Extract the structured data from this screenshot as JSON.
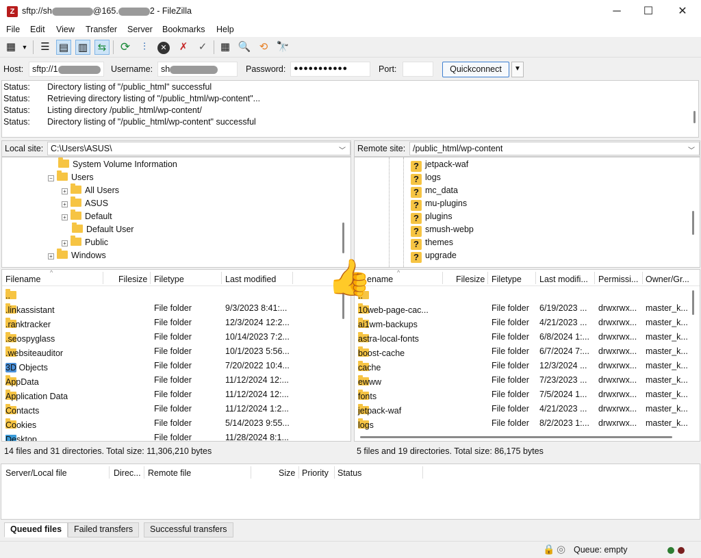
{
  "window": {
    "title_prefix": "sftp://sh",
    "title_mid": "@165.",
    "title_suffix": "2 - FileZilla",
    "app_icon": "Z"
  },
  "menu": [
    "File",
    "Edit",
    "View",
    "Transfer",
    "Server",
    "Bookmarks",
    "Help"
  ],
  "toolbar": {
    "icons": [
      "site-manager",
      "dropdown",
      "toggle-log",
      "toggle-local-tree",
      "toggle-remote-tree",
      "toggle-queue",
      "refresh",
      "process-queue",
      "cancel",
      "disconnect",
      "reconnect",
      "directory-compare",
      "filter",
      "sync-browsing",
      "search"
    ]
  },
  "quickconnect": {
    "host_label": "Host:",
    "host_value": "sftp://1",
    "username_label": "Username:",
    "username_value": "sh",
    "password_label": "Password:",
    "password_value": "●●●●●●●●●●●",
    "port_label": "Port:",
    "port_value": "",
    "button_label": "Quickconnect"
  },
  "log": [
    {
      "label": "Status:",
      "text": "Directory listing of \"/public_html\" successful"
    },
    {
      "label": "Status:",
      "text": "Retrieving directory listing of \"/public_html/wp-content\"..."
    },
    {
      "label": "Status:",
      "text": "Listing directory /public_html/wp-content/"
    },
    {
      "label": "Status:",
      "text": "Directory listing of \"/public_html/wp-content\" successful"
    }
  ],
  "local": {
    "site_label": "Local site:",
    "path": "C:\\Users\\ASUS\\",
    "tree": [
      {
        "name": "System Volume Information",
        "expander": ""
      },
      {
        "name": "Users",
        "expander": "−"
      },
      {
        "name": "All Users",
        "expander": "+"
      },
      {
        "name": "ASUS",
        "expander": "+"
      },
      {
        "name": "Default",
        "expander": "+"
      },
      {
        "name": "Default User",
        "expander": ""
      },
      {
        "name": "Public",
        "expander": "+"
      },
      {
        "name": "Windows",
        "expander": "+"
      }
    ],
    "columns": [
      "Filename",
      "Filesize",
      "Filetype",
      "Last modified"
    ],
    "files": [
      {
        "name": "..",
        "type": "",
        "modified": ""
      },
      {
        "name": ".linkassistant",
        "type": "File folder",
        "modified": "9/3/2023 8:41:..."
      },
      {
        "name": ".ranktracker",
        "type": "File folder",
        "modified": "12/3/2024 12:2..."
      },
      {
        "name": ".seospyglass",
        "type": "File folder",
        "modified": "10/14/2023 7:2..."
      },
      {
        "name": ".websiteauditor",
        "type": "File folder",
        "modified": "10/1/2023 5:56..."
      },
      {
        "name": "3D Objects",
        "type": "File folder",
        "modified": "7/20/2022 10:4..."
      },
      {
        "name": "AppData",
        "type": "File folder",
        "modified": "11/12/2024 12:..."
      },
      {
        "name": "Application Data",
        "type": "File folder",
        "modified": "11/12/2024 12:..."
      },
      {
        "name": "Contacts",
        "type": "File folder",
        "modified": "11/12/2024 1:2..."
      },
      {
        "name": "Cookies",
        "type": "File folder",
        "modified": "5/14/2023 9:55..."
      },
      {
        "name": "Desktop",
        "type": "File folder",
        "modified": "11/28/2024 8:1..."
      }
    ],
    "summary": "14 files and 31 directories. Total size: 11,306,210 bytes"
  },
  "remote": {
    "site_label": "Remote site:",
    "path": "/public_html/wp-content",
    "tree": [
      "jetpack-waf",
      "logs",
      "mc_data",
      "mu-plugins",
      "plugins",
      "smush-webp",
      "themes",
      "upgrade"
    ],
    "columns": [
      "Filename",
      "Filesize",
      "Filetype",
      "Last modifi...",
      "Permissi...",
      "Owner/Gr..."
    ],
    "header_visible_name": "ename",
    "files": [
      {
        "name": "..",
        "type": "",
        "modified": "",
        "perm": "",
        "owner": ""
      },
      {
        "name": "10web-page-cac...",
        "type": "File folder",
        "modified": "6/19/2023 ...",
        "perm": "drwxrwx...",
        "owner": "master_k..."
      },
      {
        "name": "ai1wm-backups",
        "type": "File folder",
        "modified": "4/21/2023 ...",
        "perm": "drwxrwx...",
        "owner": "master_k..."
      },
      {
        "name": "astra-local-fonts",
        "type": "File folder",
        "modified": "6/8/2024 1:...",
        "perm": "drwxrwx...",
        "owner": "master_k..."
      },
      {
        "name": "boost-cache",
        "type": "File folder",
        "modified": "6/7/2024 7:...",
        "perm": "drwxrwx...",
        "owner": "master_k..."
      },
      {
        "name": "cache",
        "type": "File folder",
        "modified": "12/3/2024 ...",
        "perm": "drwxrwx...",
        "owner": "master_k..."
      },
      {
        "name": "ewww",
        "type": "File folder",
        "modified": "7/23/2023 ...",
        "perm": "drwxrwx...",
        "owner": "master_k..."
      },
      {
        "name": "fonts",
        "type": "File folder",
        "modified": "7/5/2024 1...",
        "perm": "drwxrwx...",
        "owner": "master_k..."
      },
      {
        "name": "jetpack-waf",
        "type": "File folder",
        "modified": "4/21/2023 ...",
        "perm": "drwxrwx...",
        "owner": "master_k..."
      },
      {
        "name": "logs",
        "type": "File folder",
        "modified": "8/2/2023 1:...",
        "perm": "drwxrwx...",
        "owner": "master_k..."
      }
    ],
    "summary": "5 files and 19 directories. Total size: 86,175 bytes"
  },
  "queue": {
    "columns": [
      "Server/Local file",
      "Direc...",
      "Remote file",
      "Size",
      "Priority",
      "Status"
    ],
    "tabs": [
      "Queued files",
      "Failed transfers",
      "Successful transfers"
    ]
  },
  "statusbar": {
    "queue_text": "Queue: empty"
  },
  "overlay": {
    "emoji": "👍"
  }
}
